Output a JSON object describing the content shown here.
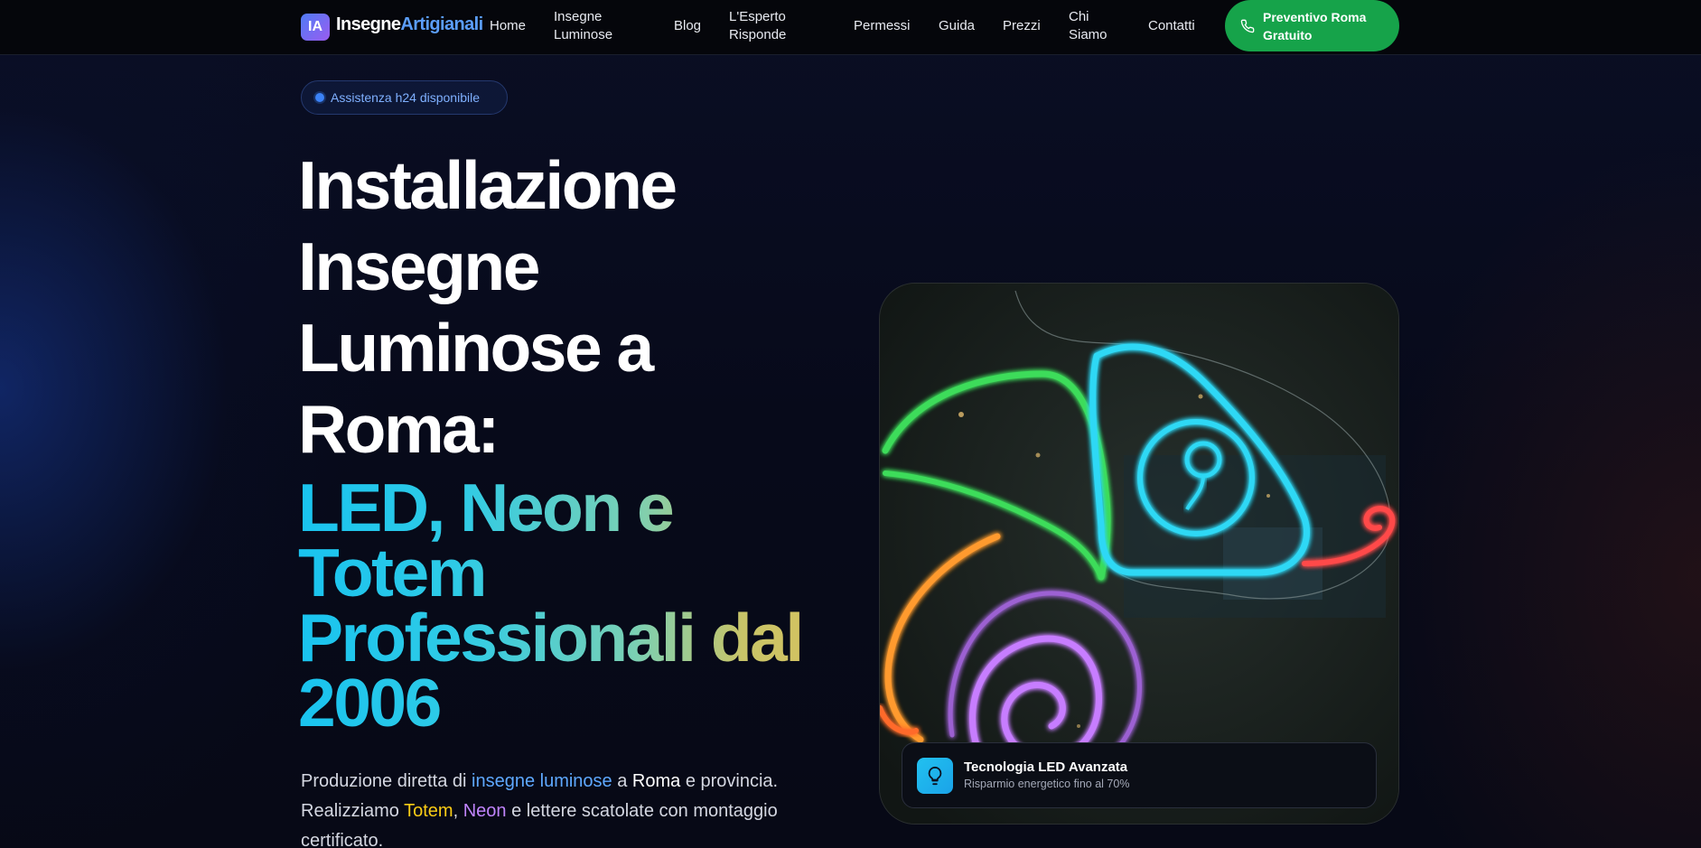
{
  "brand": {
    "badge": "IA",
    "name_part1": "Insegne",
    "name_part2": "Artigianali"
  },
  "nav": {
    "items": [
      {
        "label": "Home"
      },
      {
        "label": "Insegne Luminose"
      },
      {
        "label": "Blog"
      },
      {
        "label": "L'Esperto Risponde"
      },
      {
        "label": "Permessi"
      },
      {
        "label": "Guida"
      },
      {
        "label": "Prezzi"
      },
      {
        "label": "Chi Siamo"
      },
      {
        "label": "Contatti"
      }
    ],
    "cta_label": "Preventivo Roma Gratuito",
    "cta_icon": "phone-icon"
  },
  "hero": {
    "badge": "Assistenza h24 disponibile",
    "title_line1": "Installazione",
    "title_line2": "Insegne",
    "title_line3": "Luminose a",
    "title_line4": "Roma:",
    "subtitle_line1": "LED, Neon e",
    "subtitle_line2": "Totem",
    "subtitle_line3": "Professionali dal",
    "subtitle_line4": "2006",
    "lead": {
      "p1": "Produzione diretta di ",
      "hl1": "insegne luminose",
      "p2": " a ",
      "hl2": "Roma",
      "p3": " e provincia. Realizziamo ",
      "hl3": "Totem",
      "p4": ", ",
      "hl4": "Neon",
      "p5": " e lettere scatolate con montaggio certificato."
    }
  },
  "feature_card": {
    "icon": "lightbulb-icon",
    "title": "Tecnologia LED Avanzata",
    "subtitle": "Risparmio energetico fino al 70%"
  },
  "colors": {
    "cta_green": "#16a34a",
    "accent_blue": "#5ea8ff",
    "accent_yellow": "#facc15",
    "accent_purple": "#c084fc",
    "neon_green": "#3ddc5a",
    "neon_cyan": "#2fd8f5",
    "neon_purple": "#c77dff",
    "neon_orange": "#ff9a2e",
    "neon_red": "#ff4a4a"
  }
}
